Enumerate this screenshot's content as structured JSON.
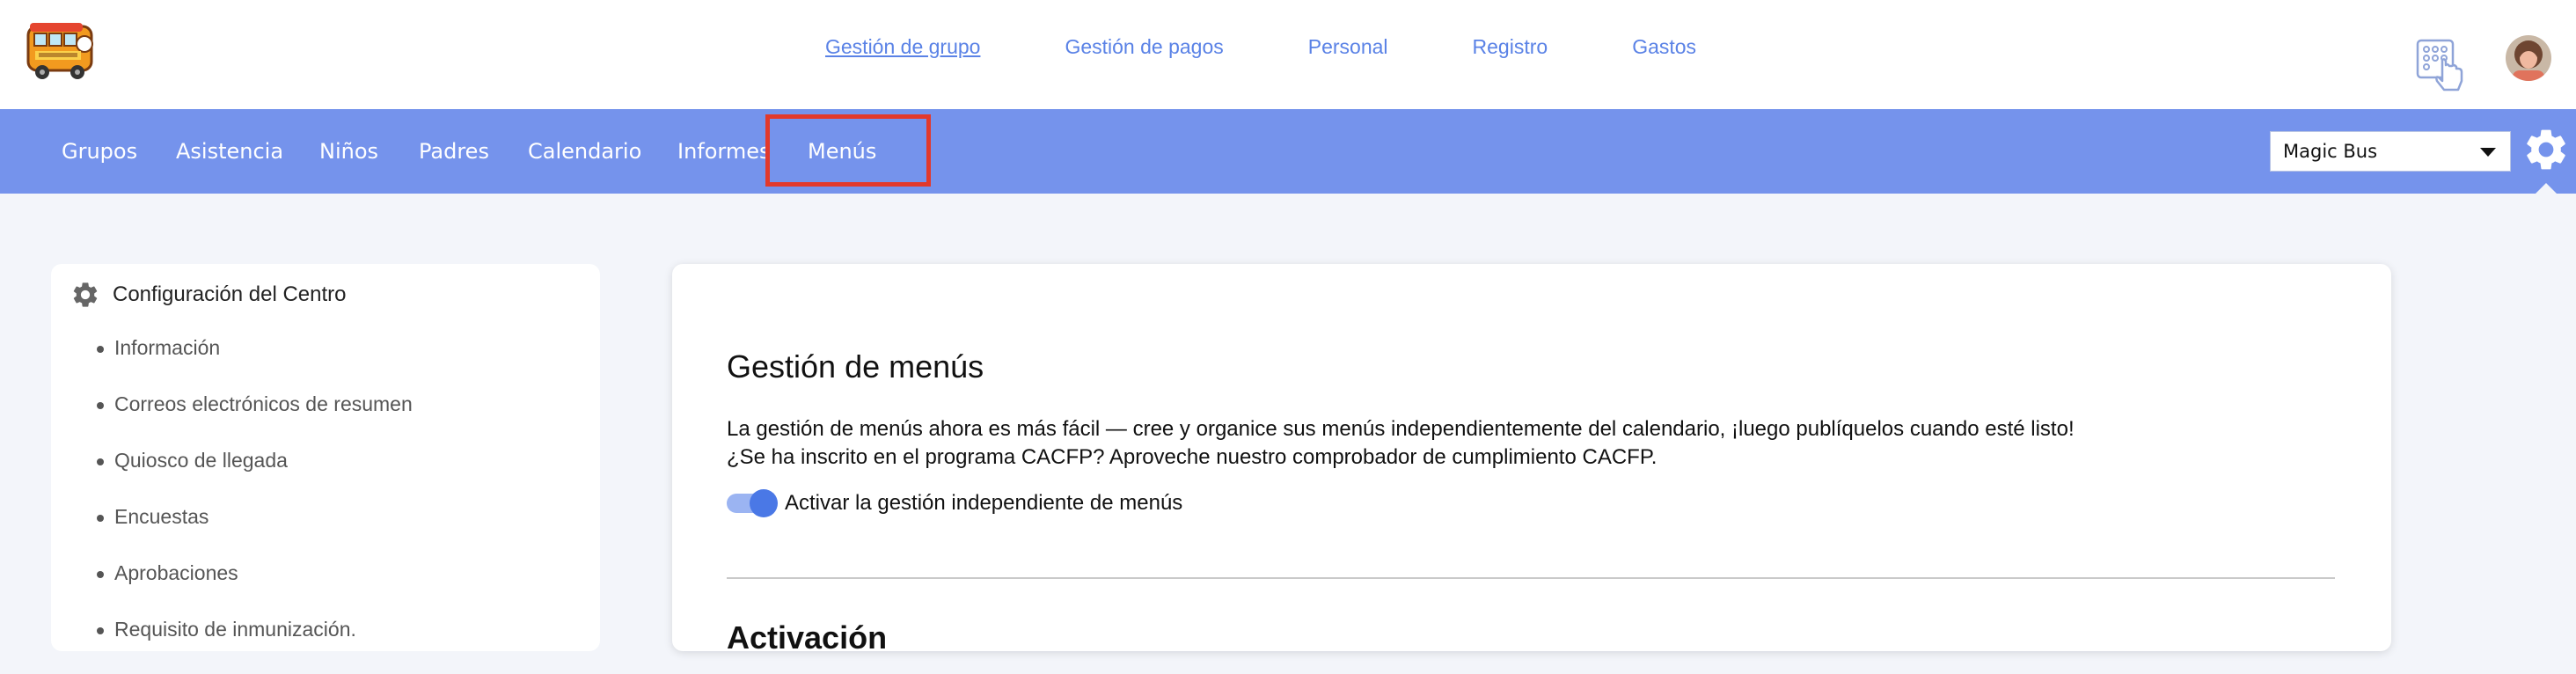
{
  "header": {
    "nav": [
      {
        "label": "Gestión de grupo",
        "active": true
      },
      {
        "label": "Gestión de pagos",
        "active": false
      },
      {
        "label": "Personal",
        "active": false
      },
      {
        "label": "Registro",
        "active": false
      },
      {
        "label": "Gastos",
        "active": false
      }
    ],
    "logo_icon": "magic-bus-logo",
    "kiosk_icon": "keypad-hand-icon",
    "avatar_icon": "user-avatar"
  },
  "subnav": {
    "tabs": [
      "Grupos",
      "Asistencia",
      "Niños",
      "Padres",
      "Calendario",
      "Informes",
      "Menús"
    ],
    "selected_tab": "Menús",
    "center_select_value": "Magic Bus",
    "settings_icon": "gear-icon",
    "highlight_color": "#e2392c",
    "background_color": "#7593ec"
  },
  "sidebar": {
    "title": "Configuración del Centro",
    "items": [
      "Información",
      "Correos electrónicos de resumen",
      "Quiosco de llegada",
      "Encuestas",
      "Aprobaciones",
      "Requisito de inmunización."
    ]
  },
  "main": {
    "title": "Gestión de menús",
    "line1": "La gestión de menús ahora es más fácil — cree y organice sus menús independientemente del calendario, ¡luego publíquelos cuando esté listo!",
    "line2": "¿Se ha inscrito en el programa CACFP? Aproveche nuestro comprobador de cumplimiento CACFP.",
    "toggle_label": "Activar la gestión independiente de menús",
    "toggle_on": true,
    "next_section_title": "Activación"
  }
}
